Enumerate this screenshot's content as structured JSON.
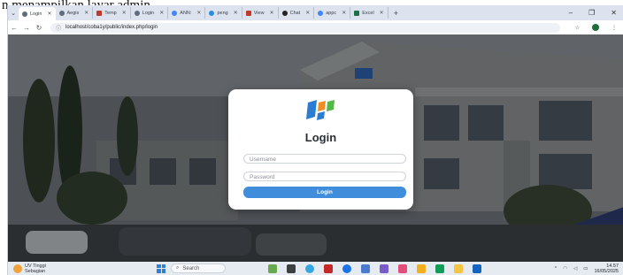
{
  "document": {
    "caption_fragment": "n menampilkan layar admin."
  },
  "browser": {
    "tabs": [
      {
        "label": "Login",
        "icon": "globe-icon",
        "active": true
      },
      {
        "label": "Aegis",
        "icon": "globe-icon"
      },
      {
        "label": "Temp",
        "icon": "pdf-icon"
      },
      {
        "label": "Login",
        "icon": "globe-icon"
      },
      {
        "label": "ANN:",
        "icon": "google-icon"
      },
      {
        "label": "peng",
        "icon": "star-icon"
      },
      {
        "label": "View",
        "icon": "pdf-icon"
      },
      {
        "label": "Chat",
        "icon": "chatgpt-icon"
      },
      {
        "label": "appc",
        "icon": "google-icon"
      },
      {
        "label": "Excel",
        "icon": "sheet-icon"
      }
    ],
    "new_tab": "+",
    "minimize": "–",
    "restore": "❐",
    "close": "✕",
    "url": "localhost/coba1y/public/index.php/login"
  },
  "login": {
    "title": "Login",
    "username_placeholder": "Username",
    "password_placeholder": "Password",
    "button": "Login"
  },
  "taskbar": {
    "weather_temp": "UV Tinggi",
    "weather_desc": "Sebagian",
    "search": "Search",
    "time": "14.57",
    "date": "16/05/2025"
  }
}
